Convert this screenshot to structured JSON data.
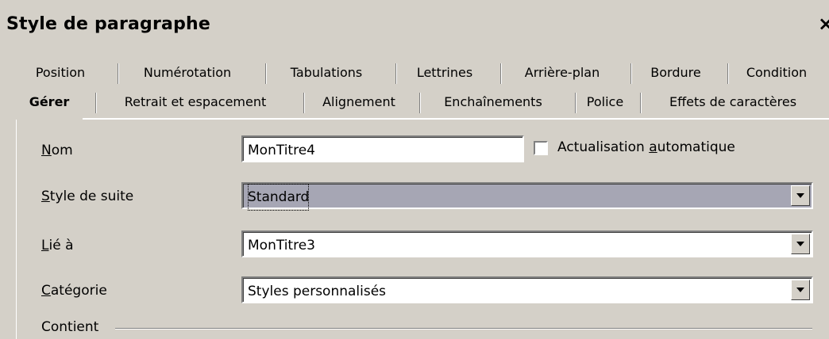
{
  "dialog": {
    "title": "Style de paragraphe",
    "close_glyph": "×"
  },
  "tabs_row1": [
    "Position",
    "Numérotation",
    "Tabulations",
    "Lettrines",
    "Arrière-plan",
    "Bordure",
    "Condition"
  ],
  "tabs_row2": [
    "Gérer",
    "Retrait et espacement",
    "Alignement",
    "Enchaînements",
    "Police",
    "Effets de caractères"
  ],
  "active_tab": "Gérer",
  "form": {
    "nom": {
      "label_u": "N",
      "label_rest": "om",
      "value": "MonTitre4"
    },
    "auto": {
      "label_pre": "Actualisation ",
      "label_u": "a",
      "label_post": "utomatique",
      "checked": false
    },
    "suite": {
      "label_u": "S",
      "label_rest": "tyle de suite",
      "value": "Standard"
    },
    "lie": {
      "label_u": "L",
      "label_rest": "ié à",
      "value": "MonTitre3"
    },
    "categorie": {
      "label_u": "C",
      "label_rest": "atégorie",
      "value": "Styles personnalisés"
    },
    "contient": "Contient"
  }
}
